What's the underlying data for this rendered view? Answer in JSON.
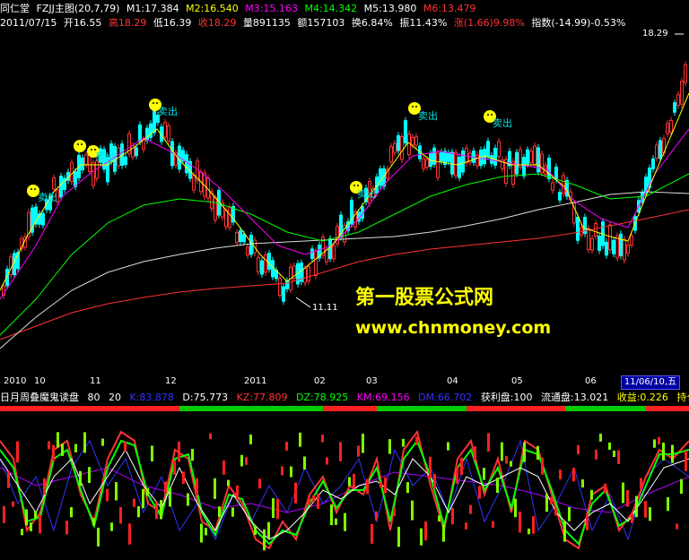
{
  "header1": {
    "app": "同仁堂",
    "indicator": "FZJJ主图(20,7,79)",
    "m1": "M1:17.384",
    "m2": "M2:16.540",
    "m3": "M3:15.163",
    "m4": "M4:14.342",
    "m5": "M5:13.980",
    "m6": "M6:13.479"
  },
  "header2": {
    "date": "2011/07/15",
    "open": "开16.55",
    "high": "高18.29",
    "low": "低16.39",
    "close": "收18.29",
    "volume": "量891135",
    "amount": "额157103",
    "turnover": "换6.84%",
    "amplitude": "振11.43%",
    "change": "涨(1.66)9.98%",
    "index": "指数(-14.99)-0.53%"
  },
  "colors": {
    "m1": "#ffffff",
    "m2": "#ffff00",
    "m3": "#ff00ff",
    "m4": "#00ff00",
    "m5": "#ffffff",
    "m6": "#ff3333",
    "up": "#ff3333",
    "down": "#00ffff"
  },
  "price_labels": {
    "max": "18.29",
    "min": "11.11"
  },
  "signals": {
    "sell": "卖出"
  },
  "axis": {
    "ticks": [
      "2010",
      "10",
      "11",
      "12",
      "2011",
      "02",
      "03",
      "04",
      "05",
      "06"
    ],
    "current": "11/06/10,五"
  },
  "watermark": {
    "line1": "第一股票公式网",
    "line2": "www.chnmoney.com"
  },
  "indicator_header": {
    "name": "日月周叠魔鬼读盘",
    "p1": "80",
    "p2": "20",
    "k": "K:83.878",
    "d": "D:75.773",
    "kz": "KZ:77.809",
    "dz": "DZ:78.925",
    "km": "KM:69.156",
    "dm": "DM:66.702",
    "profit": "获利盘:100",
    "float": "流通盘:13.021",
    "gain": "收益:0.226",
    "hold": "持仓"
  }
}
